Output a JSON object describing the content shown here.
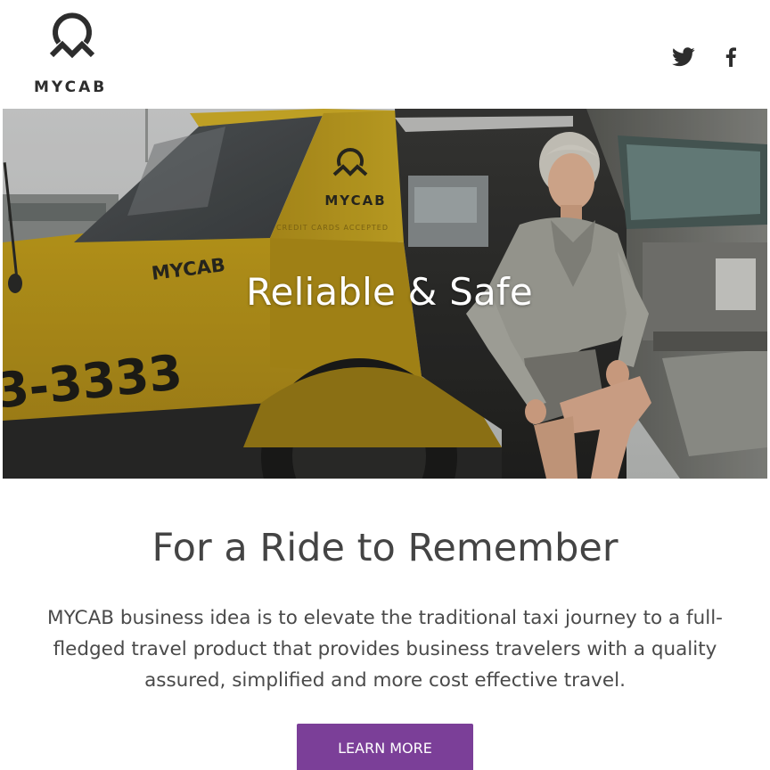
{
  "brand": {
    "name": "MYCAB",
    "logo_icon": "pin-mountain-icon",
    "accent_color": "#7b3f98",
    "taxi_color": "#f0c81d"
  },
  "header": {
    "social": [
      {
        "name": "twitter",
        "icon": "twitter-icon"
      },
      {
        "name": "facebook",
        "icon": "facebook-icon"
      }
    ]
  },
  "hero": {
    "title": "Reliable & Safe",
    "photo": {
      "door_brand": "MYCAB",
      "door_tagline": "CREDIT CARDS ACCEPTED",
      "fender_brand": "MYCAB",
      "phone_fragment": "3-3333"
    }
  },
  "content": {
    "headline": "For a Ride to Remember",
    "description": "MYCAB business idea is to elevate the traditional taxi journey to a full-fledged travel product that provides business travelers with a quality assured, simplified and more cost effective travel.",
    "cta_label": "LEARN MORE"
  }
}
